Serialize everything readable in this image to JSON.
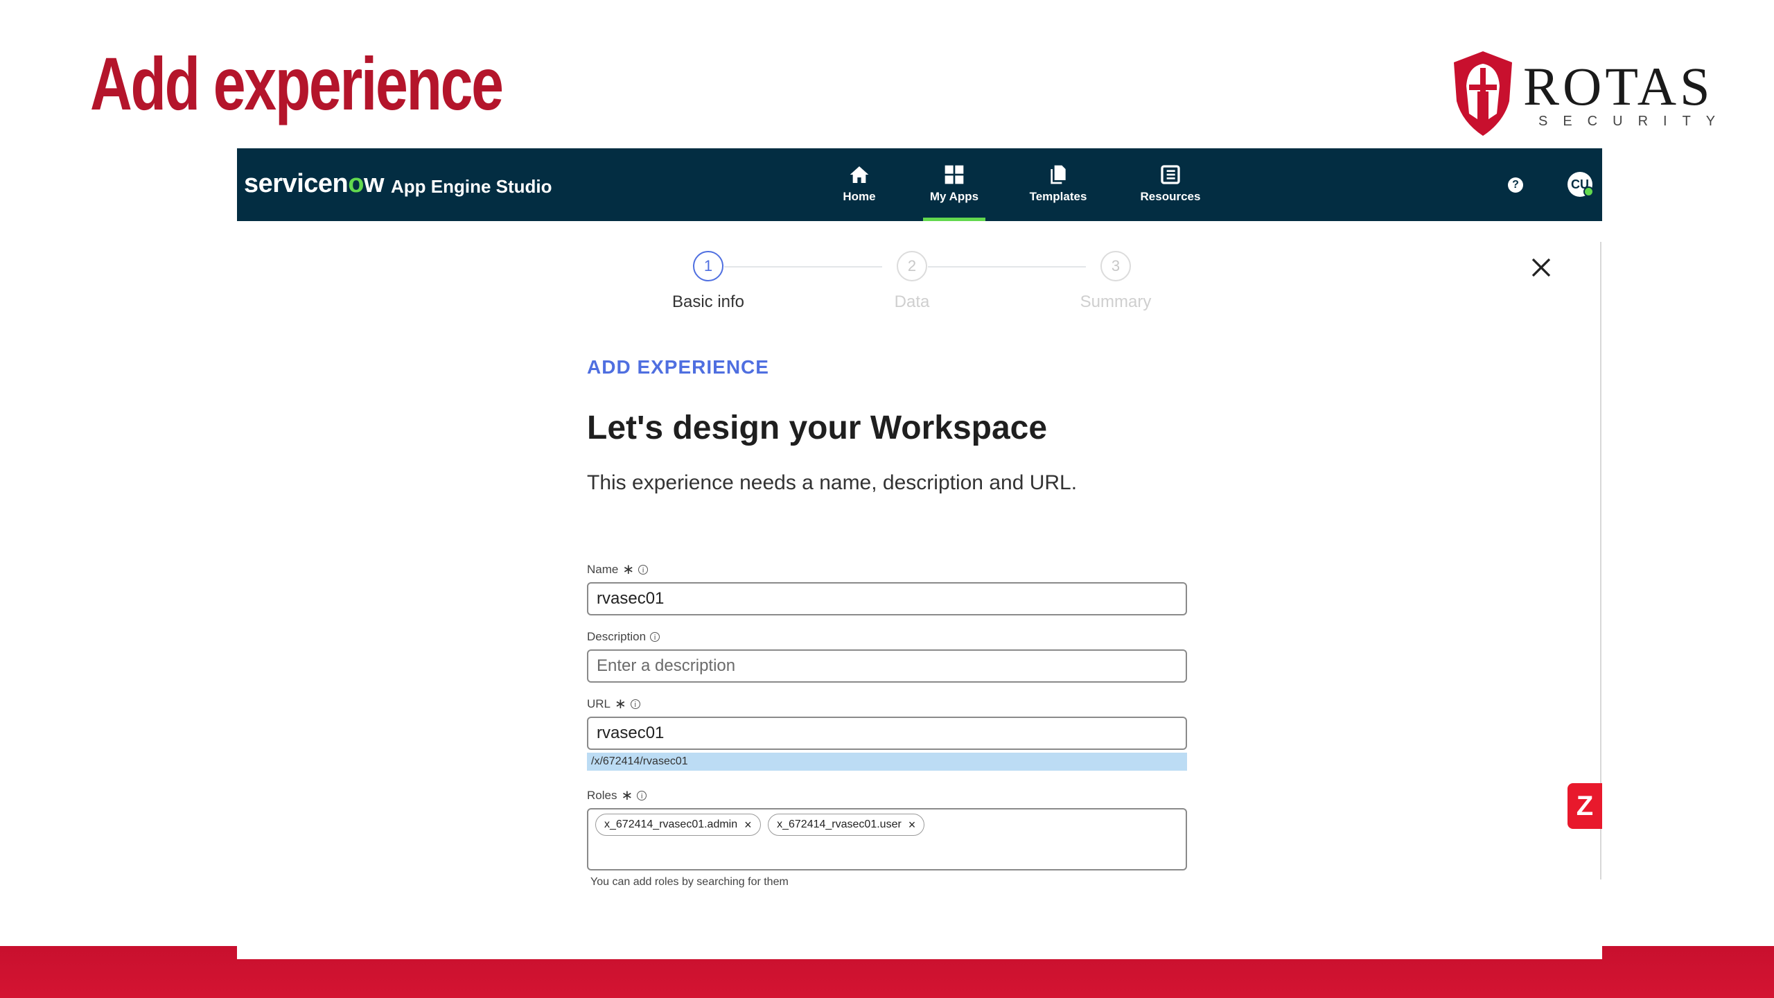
{
  "slide": {
    "title": "Add experience",
    "logo": {
      "word": "ROTAS",
      "sub": "SECURITY"
    }
  },
  "topbar": {
    "brand_prefix": "servicen",
    "brand_o": "o",
    "brand_suffix": "w",
    "product": "App Engine Studio",
    "nav": [
      {
        "label": "Home",
        "icon": "home-icon"
      },
      {
        "label": "My Apps",
        "icon": "grid-icon",
        "active": true
      },
      {
        "label": "Templates",
        "icon": "templates-icon"
      },
      {
        "label": "Resources",
        "icon": "resources-icon"
      }
    ],
    "help": "?",
    "avatar_initials": "CU"
  },
  "stepper": {
    "steps": [
      {
        "number": "1",
        "label": "Basic info",
        "active": true
      },
      {
        "number": "2",
        "label": "Data"
      },
      {
        "number": "3",
        "label": "Summary"
      }
    ]
  },
  "form": {
    "eyebrow": "ADD EXPERIENCE",
    "heading": "Let's design your Workspace",
    "intro": "This experience needs a name, description and URL.",
    "name": {
      "label": "Name",
      "value": "rvasec01"
    },
    "description": {
      "label": "Description",
      "placeholder": "Enter a description"
    },
    "url": {
      "label": "URL",
      "value": "rvasec01",
      "path": "/x/672414/rvasec01"
    },
    "roles": {
      "label": "Roles",
      "chips": [
        "x_672414_rvasec01.admin",
        "x_672414_rvasec01.user"
      ],
      "helper": "You can add roles by searching for them"
    }
  },
  "colors": {
    "title_red": "#b4152b",
    "topbar_bg": "#032d42",
    "accent_green": "#62d84e",
    "accent_blue": "#4f6fe0",
    "band_red": "#c8102e"
  }
}
